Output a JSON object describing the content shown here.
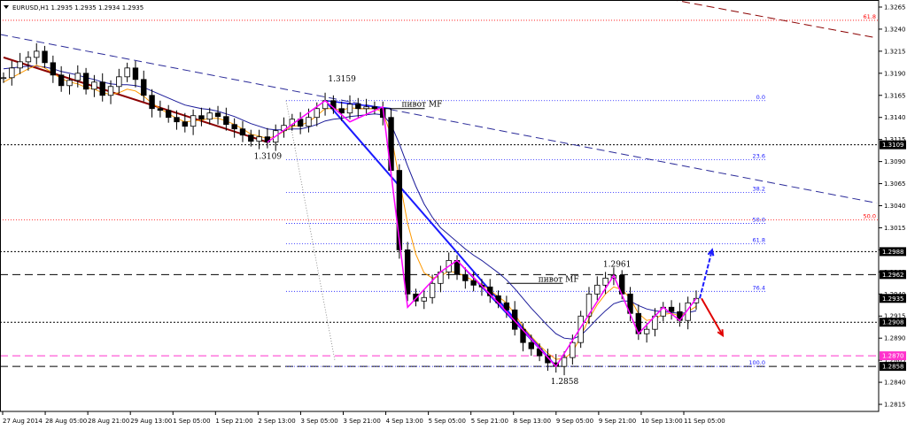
{
  "chart_data": {
    "type": "candlestick",
    "header": "EURUSD,H1  1.2935 1.2935 1.2934 1.2935",
    "symbol_icon": "triangle-down-icon",
    "ylim": [
      1.2807,
      1.3273
    ],
    "y_ticks": [
      "1.3265",
      "1.3240",
      "1.3215",
      "1.3190",
      "1.3165",
      "1.3140",
      "1.3115",
      "1.3090",
      "1.3065",
      "1.3040",
      "1.3015",
      "1.2990",
      "1.2965",
      "1.2940",
      "1.2915",
      "1.2890",
      "1.2865",
      "1.2840",
      "1.2815"
    ],
    "x_ticks": [
      "27 Aug 2014",
      "28 Aug 05:00",
      "28 Aug 21:00",
      "29 Aug 13:00",
      "1 Sep 05:00",
      "1 Sep 21:00",
      "2 Sep 13:00",
      "3 Sep 05:00",
      "3 Sep 21:00",
      "4 Sep 13:00",
      "5 Sep 05:00",
      "5 Sep 21:00",
      "8 Sep 13:00",
      "9 Sep 05:00",
      "9 Sep 21:00",
      "10 Sep 13:00",
      "11 Sep 05:00"
    ],
    "price_series": [
      1.3185,
      1.3196,
      1.3203,
      1.3208,
      1.3215,
      1.3202,
      1.3188,
      1.3176,
      1.3182,
      1.319,
      1.3172,
      1.318,
      1.3165,
      1.3175,
      1.3186,
      1.3196,
      1.3183,
      1.3165,
      1.315,
      1.3148,
      1.314,
      1.3135,
      1.313,
      1.3142,
      1.3138,
      1.3145,
      1.3141,
      1.3132,
      1.3127,
      1.312,
      1.3113,
      1.3118,
      1.3112,
      1.3125,
      1.3131,
      1.3138,
      1.313,
      1.314,
      1.315,
      1.3159,
      1.315,
      1.3145,
      1.3155,
      1.315,
      1.3152,
      1.315,
      1.314,
      1.308,
      1.299,
      1.294,
      1.2932,
      1.2936,
      1.2952,
      1.2965,
      1.2978,
      1.2962,
      1.2955,
      1.295,
      1.2948,
      1.2938,
      1.293,
      1.2922,
      1.29,
      1.2885,
      1.2878,
      1.287,
      1.2862,
      1.2858,
      1.2868,
      1.2885,
      1.2915,
      1.294,
      1.295,
      1.2958,
      1.2961,
      1.294,
      1.2918,
      1.2895,
      1.29,
      1.2915,
      1.2925,
      1.292,
      1.291,
      1.293,
      1.2935
    ],
    "ma_fast_series": [
      1.318,
      1.3185,
      1.319,
      1.3195,
      1.3199,
      1.3196,
      1.319,
      1.3184,
      1.318,
      1.3178,
      1.3174,
      1.3172,
      1.3168,
      1.3166,
      1.3168,
      1.3172,
      1.317,
      1.3164,
      1.3156,
      1.315,
      1.3144,
      1.3139,
      1.3135,
      1.3136,
      1.3137,
      1.3139,
      1.3139,
      1.3136,
      1.3132,
      1.3127,
      1.3121,
      1.3119,
      1.3116,
      1.3119,
      1.3124,
      1.313,
      1.3131,
      1.3135,
      1.3142,
      1.315,
      1.315,
      1.3148,
      1.3151,
      1.315,
      1.315,
      1.315,
      1.3146,
      1.312,
      1.307,
      1.302,
      1.2985,
      1.2964,
      1.2958,
      1.296,
      1.2966,
      1.2964,
      1.296,
      1.2955,
      1.2951,
      1.2944,
      1.2937,
      1.293,
      1.2917,
      1.2903,
      1.2892,
      1.2882,
      1.2873,
      1.2866,
      1.2867,
      1.2874,
      1.2892,
      1.2912,
      1.2928,
      1.294,
      1.2948,
      1.2945,
      1.2935,
      1.2918,
      1.291,
      1.2912,
      1.2917,
      1.2918,
      1.2915,
      1.292,
      1.2926
    ],
    "ma_slow_series": [
      1.3195,
      1.3196,
      1.3197,
      1.3198,
      1.3198,
      1.3197,
      1.3195,
      1.3192,
      1.319,
      1.3188,
      1.3185,
      1.3183,
      1.318,
      1.3178,
      1.3177,
      1.3177,
      1.3176,
      1.3174,
      1.317,
      1.3166,
      1.3162,
      1.3158,
      1.3154,
      1.3152,
      1.315,
      1.3149,
      1.3147,
      1.3144,
      1.3141,
      1.3137,
      1.3133,
      1.313,
      1.3127,
      1.3126,
      1.3126,
      1.3127,
      1.3127,
      1.3129,
      1.3132,
      1.3136,
      1.3138,
      1.3139,
      1.3141,
      1.3142,
      1.3143,
      1.3144,
      1.3143,
      1.3132,
      1.311,
      1.3085,
      1.3062,
      1.3042,
      1.3027,
      1.3015,
      1.3007,
      1.2999,
      1.2991,
      1.2984,
      1.2978,
      1.2971,
      1.2964,
      1.2956,
      1.2946,
      1.2935,
      1.2924,
      1.2914,
      1.2904,
      1.2895,
      1.289,
      1.2889,
      1.2893,
      1.2902,
      1.2912,
      1.2921,
      1.2929,
      1.2932,
      1.2932,
      1.2927,
      1.2923,
      1.2921,
      1.292,
      1.2919,
      1.2918,
      1.2919,
      1.2921
    ],
    "price_boxes": [
      {
        "label": "1.3109",
        "value": 1.3109,
        "color": "#000000"
      },
      {
        "label": "1.2988",
        "value": 1.2988,
        "color": "#000000"
      },
      {
        "label": "1.2962",
        "value": 1.2962,
        "color": "#000000"
      },
      {
        "label": "1.2935",
        "value": 1.2935,
        "color": "#000000"
      },
      {
        "label": "1.2908",
        "value": 1.2908,
        "color": "#000000"
      },
      {
        "label": "1.2870",
        "value": 1.287,
        "color": "#ff33cc"
      },
      {
        "label": "1.2858",
        "value": 1.2858,
        "color": "#000000"
      }
    ],
    "fib_levels": [
      {
        "label": "0.0",
        "value": 1.3159
      },
      {
        "label": "23.6",
        "value": 1.3092
      },
      {
        "label": "38.2",
        "value": 1.3055
      },
      {
        "label": "50.0",
        "value": 1.302
      },
      {
        "label": "61.8",
        "value": 1.2997
      },
      {
        "label": "76.4",
        "value": 1.2943
      },
      {
        "label": "100.0",
        "value": 1.2858
      }
    ],
    "red_fib_labels": [
      {
        "label": "61.8",
        "value": 1.325
      },
      {
        "label": "50.0",
        "value": 1.3024
      }
    ],
    "annotations": [
      {
        "text": "1.3159",
        "kind": "high"
      },
      {
        "text": "1.3109",
        "kind": "low"
      },
      {
        "text": "1.2858",
        "kind": "low"
      },
      {
        "text": "1.2961",
        "kind": "high"
      },
      {
        "text": "пивот MF",
        "kind": "pivot"
      },
      {
        "text": "пивот MF",
        "kind": "pivot"
      }
    ],
    "colors": {
      "candle": "#000000",
      "ma_fast": "#ff9900",
      "ma_slow": "#1a1a99",
      "downtrend": "#1a1aff",
      "early_trend": "#8b0000",
      "zigzag": "#ff00ff",
      "fib": "#1a1aff",
      "red_level": "#ff0000",
      "pink_level": "#ff33cc",
      "arrow_up": "#1a1aff",
      "arrow_down": "#e00000"
    },
    "grid": false
  }
}
